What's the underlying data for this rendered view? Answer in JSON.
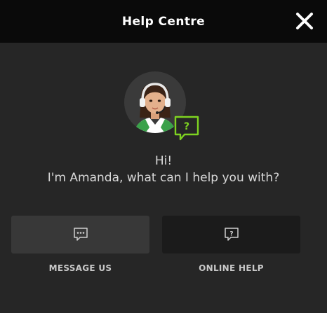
{
  "header": {
    "title": "Help Centre",
    "close_icon": "close-icon"
  },
  "agent": {
    "avatar_icon": "support-agent-avatar",
    "badge_icon": "help-chat-bubble-icon",
    "badge_text": "?",
    "greeting_line1": "Hi!",
    "greeting_line2": "I'm Amanda, what can I help you with?"
  },
  "actions": [
    {
      "label": "MESSAGE US",
      "icon": "chat-bubble-dots-icon"
    },
    {
      "label": "ONLINE HELP",
      "icon": "chat-bubble-question-icon",
      "icon_text": "?"
    }
  ],
  "colors": {
    "accent": "#7ed321",
    "header_bg": "#0a0a0a",
    "page_bg": "#262626"
  }
}
